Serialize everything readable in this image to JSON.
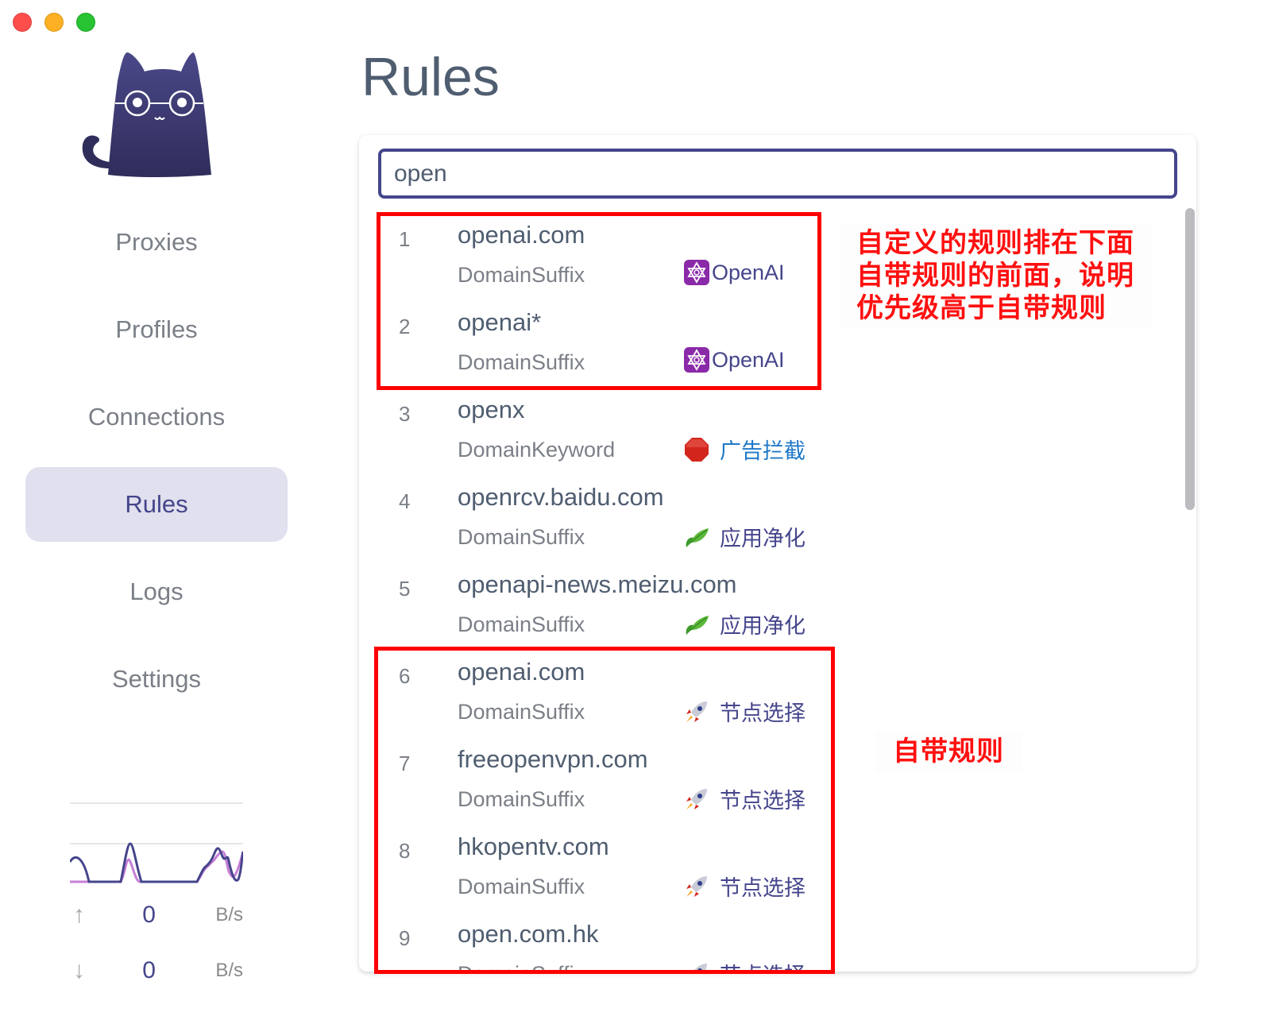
{
  "window": {
    "controls": [
      "close",
      "minimize",
      "maximize"
    ]
  },
  "sidebar": {
    "logo": "cat-with-glasses-logo",
    "nav": [
      {
        "label": "Proxies",
        "active": false
      },
      {
        "label": "Profiles",
        "active": false
      },
      {
        "label": "Connections",
        "active": false
      },
      {
        "label": "Rules",
        "active": true
      },
      {
        "label": "Logs",
        "active": false
      },
      {
        "label": "Settings",
        "active": false
      }
    ],
    "traffic": {
      "upload": {
        "arrow": "↑",
        "value": "0",
        "unit": "B/s"
      },
      "download": {
        "arrow": "↓",
        "value": "0",
        "unit": "B/s"
      },
      "colors": {
        "upload": "#c77fd6",
        "download": "#45458c"
      }
    }
  },
  "main": {
    "title": "Rules",
    "search": {
      "value": "open",
      "placeholder": ""
    },
    "rules": [
      {
        "index": "1",
        "payload": "openai.com",
        "type": "DomainSuffix",
        "proxy": "OpenAI",
        "proxy_icon": "star-of-david-icon"
      },
      {
        "index": "2",
        "payload": "openai*",
        "type": "DomainSuffix",
        "proxy": "OpenAI",
        "proxy_icon": "star-of-david-icon"
      },
      {
        "index": "3",
        "payload": "openx",
        "type": "DomainKeyword",
        "proxy": "广告拦截",
        "proxy_icon": "stop-sign-icon"
      },
      {
        "index": "4",
        "payload": "openrcv.baidu.com",
        "type": "DomainSuffix",
        "proxy": "应用净化",
        "proxy_icon": "leaf-icon"
      },
      {
        "index": "5",
        "payload": "openapi-news.meizu.com",
        "type": "DomainSuffix",
        "proxy": "应用净化",
        "proxy_icon": "leaf-icon"
      },
      {
        "index": "6",
        "payload": "openai.com",
        "type": "DomainSuffix",
        "proxy": "节点选择",
        "proxy_icon": "rocket-icon"
      },
      {
        "index": "7",
        "payload": "freeopenvpn.com",
        "type": "DomainSuffix",
        "proxy": "节点选择",
        "proxy_icon": "rocket-icon"
      },
      {
        "index": "8",
        "payload": "hkopentv.com",
        "type": "DomainSuffix",
        "proxy": "节点选择",
        "proxy_icon": "rocket-icon"
      },
      {
        "index": "9",
        "payload": "open.com.hk",
        "type": "DomainSuffix",
        "proxy": "节点选择",
        "proxy_icon": "rocket-icon"
      }
    ]
  },
  "annotations": {
    "custom_rules_note": [
      "自定义的规则排在下面",
      "自带规则的前面，说明",
      "优先级高于自带规则"
    ],
    "builtin_rules_note": "自带规则",
    "color": "#ff0000"
  }
}
